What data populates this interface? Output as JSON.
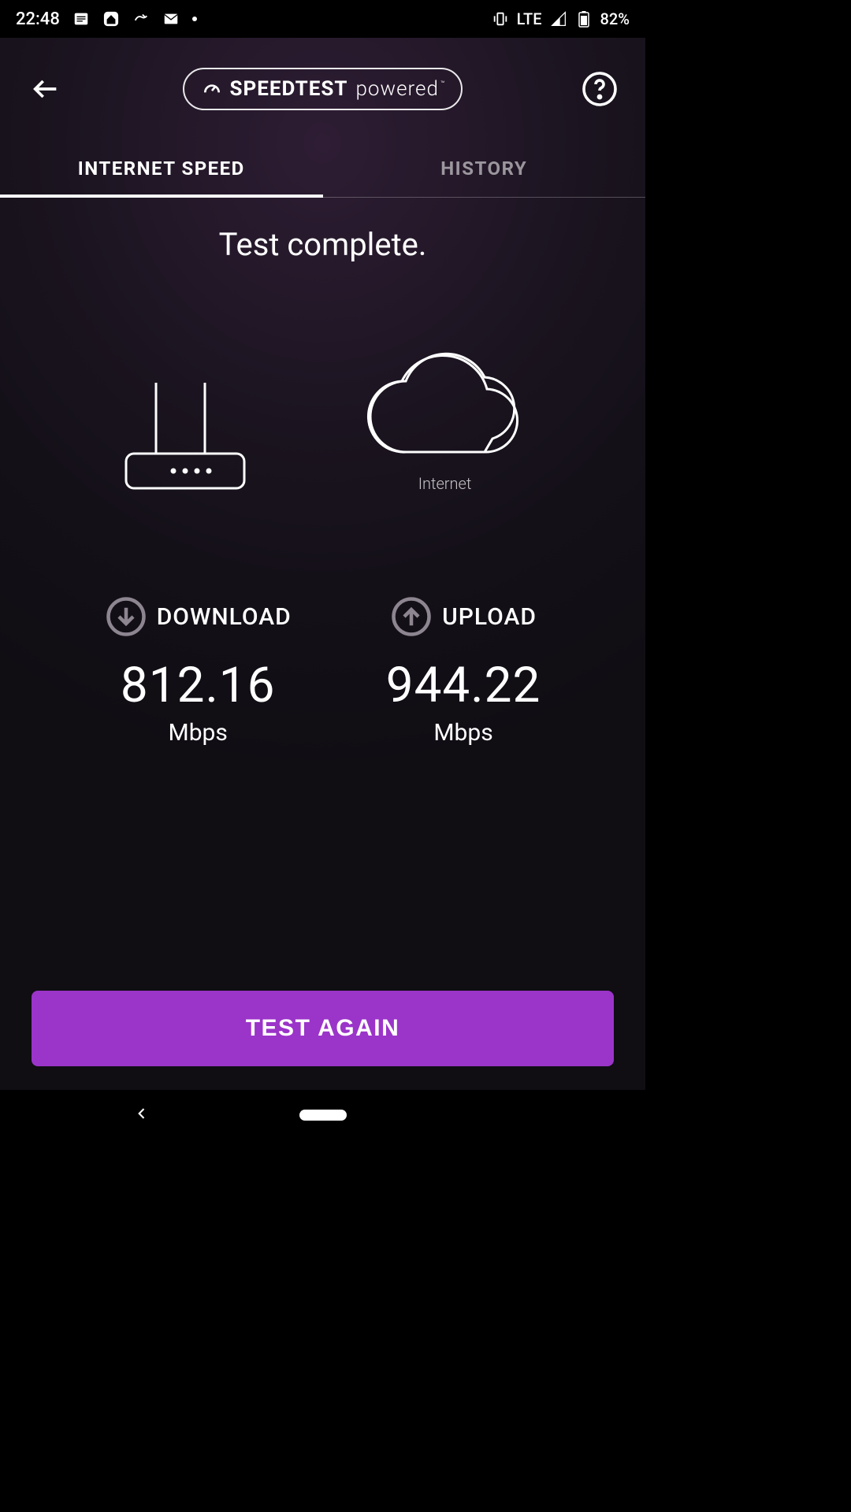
{
  "status_bar": {
    "time": "22:48",
    "network_type": "LTE",
    "battery": "82%"
  },
  "header": {
    "brand_main": "SPEEDTEST",
    "brand_sub": "powered",
    "tm": "™"
  },
  "tabs": {
    "speed": "INTERNET SPEED",
    "history": "HISTORY"
  },
  "main": {
    "status_text": "Test complete.",
    "cloud_label": "Internet",
    "download": {
      "label": "DOWNLOAD",
      "value": "812.16",
      "unit": "Mbps"
    },
    "upload": {
      "label": "UPLOAD",
      "value": "944.22",
      "unit": "Mbps"
    }
  },
  "button": {
    "test_again": "TEST AGAIN"
  }
}
